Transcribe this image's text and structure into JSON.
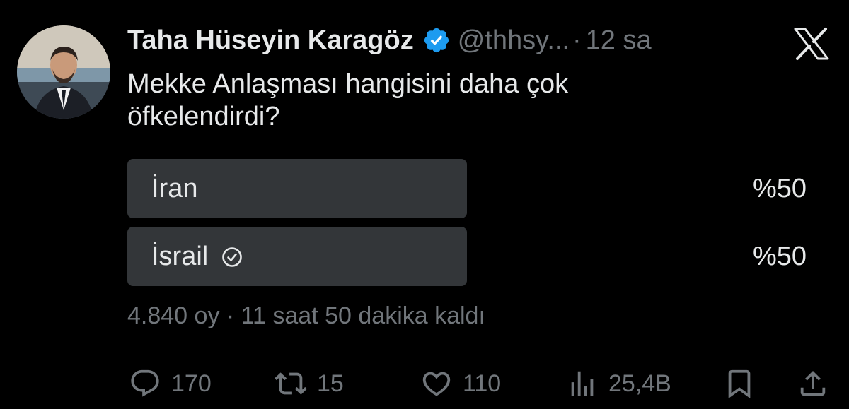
{
  "tweet": {
    "author_name": "Taha Hüseyin Karagöz",
    "handle": "@thhsy...",
    "separator": "·",
    "time": "12 sa",
    "text": "Mekke Anlaşması hangisini daha çok öfkelendirdi?",
    "accent_color": "#1d9bf0"
  },
  "poll": {
    "options": [
      {
        "label": "İran",
        "percent_text": "%50",
        "share": 0.5,
        "selected": false
      },
      {
        "label": "İsrail",
        "percent_text": "%50",
        "share": 0.5,
        "selected": true
      }
    ],
    "meta": "4.840 oy · 11 saat 50 dakika kaldı"
  },
  "actions": {
    "reply_count": "170",
    "retweet_count": "15",
    "like_count": "110",
    "views_count": "25,4B"
  },
  "icons": {
    "brand": "x-logo-icon",
    "verified": "verified-badge-icon",
    "reply": "reply-icon",
    "retweet": "retweet-icon",
    "like": "heart-icon",
    "views": "views-chart-icon",
    "bookmark": "bookmark-icon",
    "share": "share-icon"
  }
}
